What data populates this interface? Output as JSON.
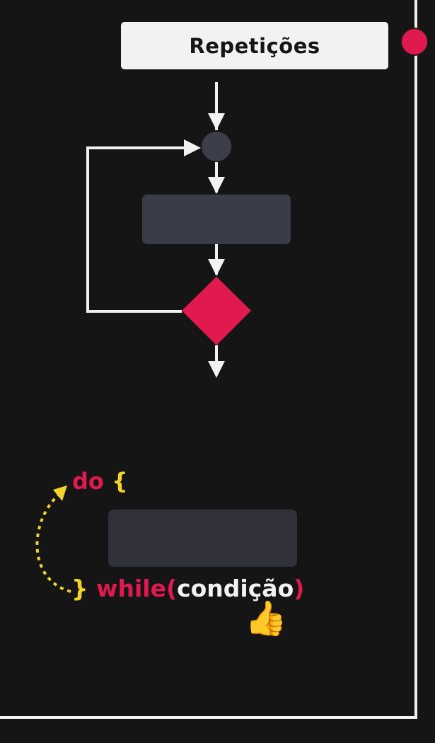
{
  "header": {
    "title": "Repetições"
  },
  "code": {
    "do_keyword": "do",
    "open_brace": "{",
    "close_brace": "}",
    "while_keyword": "while",
    "open_paren": "(",
    "condition": "condição",
    "close_paren": ")"
  },
  "emoji": {
    "thumbs_up": "👍"
  },
  "colors": {
    "accent_red": "#e0194f",
    "brace_yellow": "#f3d22c",
    "block_gray": "#3a3c48",
    "background": "#151515",
    "line_white": "#f2f2f2"
  }
}
